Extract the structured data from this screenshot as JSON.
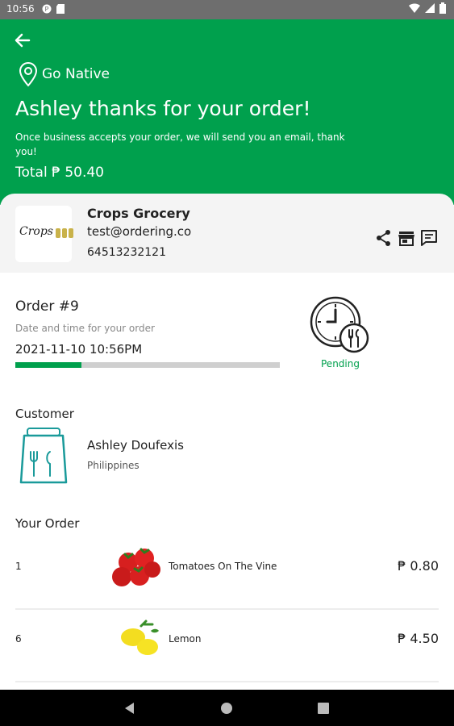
{
  "status_bar": {
    "time": "10:56"
  },
  "header": {
    "brand": "Go Native",
    "title": "Ashley thanks for your order!",
    "subtitle": "Once business accepts your order, we will send you an email, thank you!",
    "total_label": "Total",
    "total_value": "₱ 50.40",
    "color": "#00a04d"
  },
  "business": {
    "name": "Crops Grocery",
    "email": "test@ordering.co",
    "phone": "64513232121",
    "logo_text": "Crops"
  },
  "order": {
    "title": "Order #9",
    "date_label": "Date and time for your order",
    "date": "2021-11-10 10:56PM",
    "progress": 0.25,
    "status": "Pending"
  },
  "customer": {
    "section_title": "Customer",
    "name": "Ashley Doufexis",
    "country": "Philippines"
  },
  "your_order": {
    "section_title": "Your Order",
    "items": [
      {
        "qty": "1",
        "name": "Tomatoes On The Vine",
        "price": "₱ 0.80",
        "icon": "tomatoes-icon"
      },
      {
        "qty": "6",
        "name": "Lemon",
        "price": "₱ 4.50",
        "icon": "lemon-icon"
      }
    ]
  }
}
